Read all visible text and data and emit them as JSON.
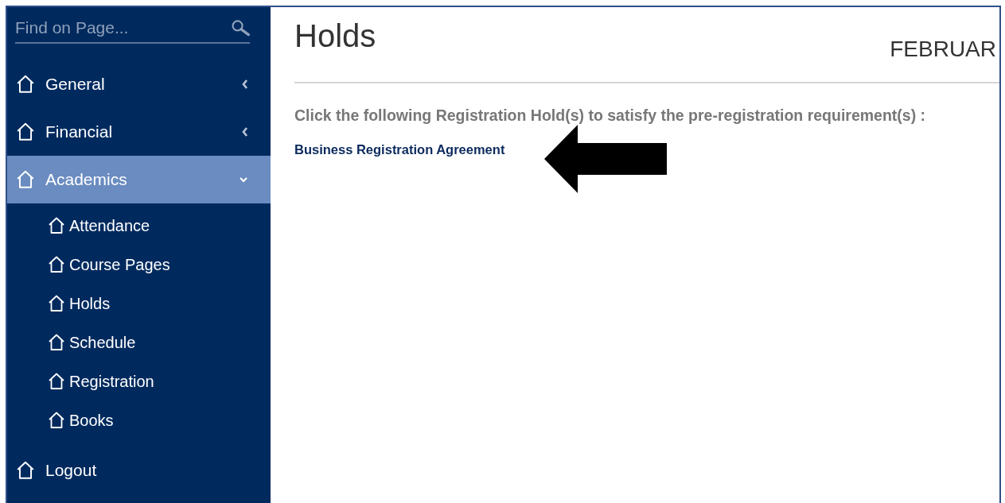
{
  "sidebar": {
    "search": {
      "placeholder": "Find on Page..."
    },
    "items": [
      {
        "label": "General",
        "kind": "group",
        "expanded": false
      },
      {
        "label": "Financial",
        "kind": "group",
        "expanded": false
      },
      {
        "label": "Academics",
        "kind": "group",
        "expanded": true,
        "children": [
          {
            "label": "Attendance"
          },
          {
            "label": "Course Pages"
          },
          {
            "label": "Holds"
          },
          {
            "label": "Schedule"
          },
          {
            "label": "Registration"
          },
          {
            "label": "Books"
          }
        ]
      },
      {
        "label": "Logout",
        "kind": "link"
      }
    ]
  },
  "main": {
    "title": "Holds",
    "date": "FEBRUAR",
    "instruction": "Click the following Registration Hold(s) to satisfy the pre-registration requirement(s) :",
    "holds": [
      "Business Registration Agreement"
    ]
  }
}
